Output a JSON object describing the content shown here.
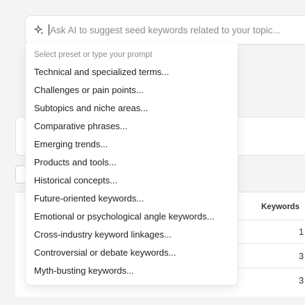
{
  "ai_prompt": {
    "placeholder": "Ask AI to suggest seed keywords related to your topic..."
  },
  "dropdown": {
    "header": "Select preset or type your prompt",
    "options": [
      "Technical and specialized terms...",
      "Challenges or pain points...",
      "Subtopics and niche areas...",
      "Comparative phrases...",
      "Emerging trends...",
      "Products and tools...",
      "Historical concepts...",
      "Future-oriented keywords...",
      "Emotional or psychological angle keywords...",
      "Cross-industry keyword linkages...",
      "Controversial or debate keywords...",
      "Myth-busting keywords..."
    ]
  },
  "table": {
    "column_header": "Keywords",
    "values": [
      "1",
      "3",
      "3"
    ]
  },
  "icons": {
    "prompt": "sparkle-icon"
  }
}
